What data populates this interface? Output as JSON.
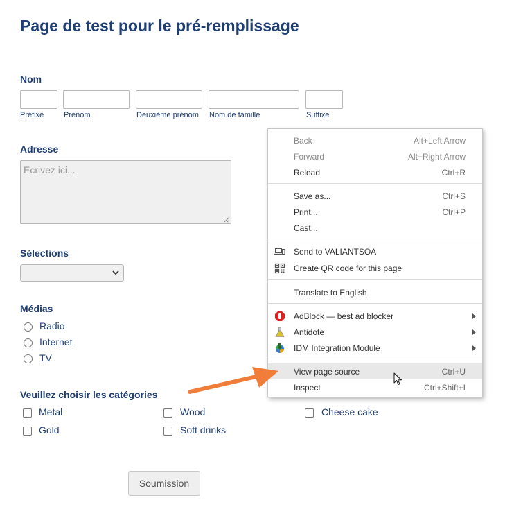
{
  "page": {
    "title": "Page de test pour le pré-remplissage"
  },
  "name_section": {
    "label": "Nom",
    "fields": [
      {
        "sublabel": "Préfixe"
      },
      {
        "sublabel": "Prénom"
      },
      {
        "sublabel": "Deuxième prénom"
      },
      {
        "sublabel": "Nom de famille"
      },
      {
        "sublabel": "Suffixe"
      }
    ]
  },
  "address_section": {
    "label": "Adresse",
    "placeholder": "Ecrivez ici..."
  },
  "selections_section": {
    "label": "Sélections",
    "selected_value": ""
  },
  "media_section": {
    "label": "Médias",
    "options": [
      "Radio",
      "Internet",
      "TV"
    ]
  },
  "categories_section": {
    "label": "Veuillez choisir les catégories",
    "options": [
      "Metal",
      "Wood",
      "Cheese cake",
      "Gold",
      "Soft drinks"
    ]
  },
  "submit": {
    "label": "Soumission"
  },
  "context_menu": {
    "items": [
      {
        "label": "Back",
        "shortcut": "Alt+Left Arrow",
        "disabled": true
      },
      {
        "label": "Forward",
        "shortcut": "Alt+Right Arrow",
        "disabled": true
      },
      {
        "label": "Reload",
        "shortcut": "Ctrl+R"
      },
      {
        "label": "Save as...",
        "shortcut": "Ctrl+S"
      },
      {
        "label": "Print...",
        "shortcut": "Ctrl+P"
      },
      {
        "label": "Cast..."
      },
      {
        "label": "Send to VALIANTSOA",
        "icon": "laptop-phone-icon"
      },
      {
        "label": "Create QR code for this page",
        "icon": "qr-code-icon"
      },
      {
        "label": "Translate to English"
      },
      {
        "label": "AdBlock — best ad blocker",
        "icon": "adblock-icon",
        "submenu": true
      },
      {
        "label": "Antidote",
        "icon": "antidote-flask-icon",
        "submenu": true
      },
      {
        "label": "IDM Integration Module",
        "icon": "idm-icon",
        "submenu": true
      },
      {
        "label": "View page source",
        "shortcut": "Ctrl+U",
        "highlighted": true
      },
      {
        "label": "Inspect",
        "shortcut": "Ctrl+Shift+I"
      }
    ]
  },
  "colors": {
    "heading": "#1f3e74",
    "arrow_annotation": "#f07e3a",
    "adblock_red": "#e02020"
  }
}
